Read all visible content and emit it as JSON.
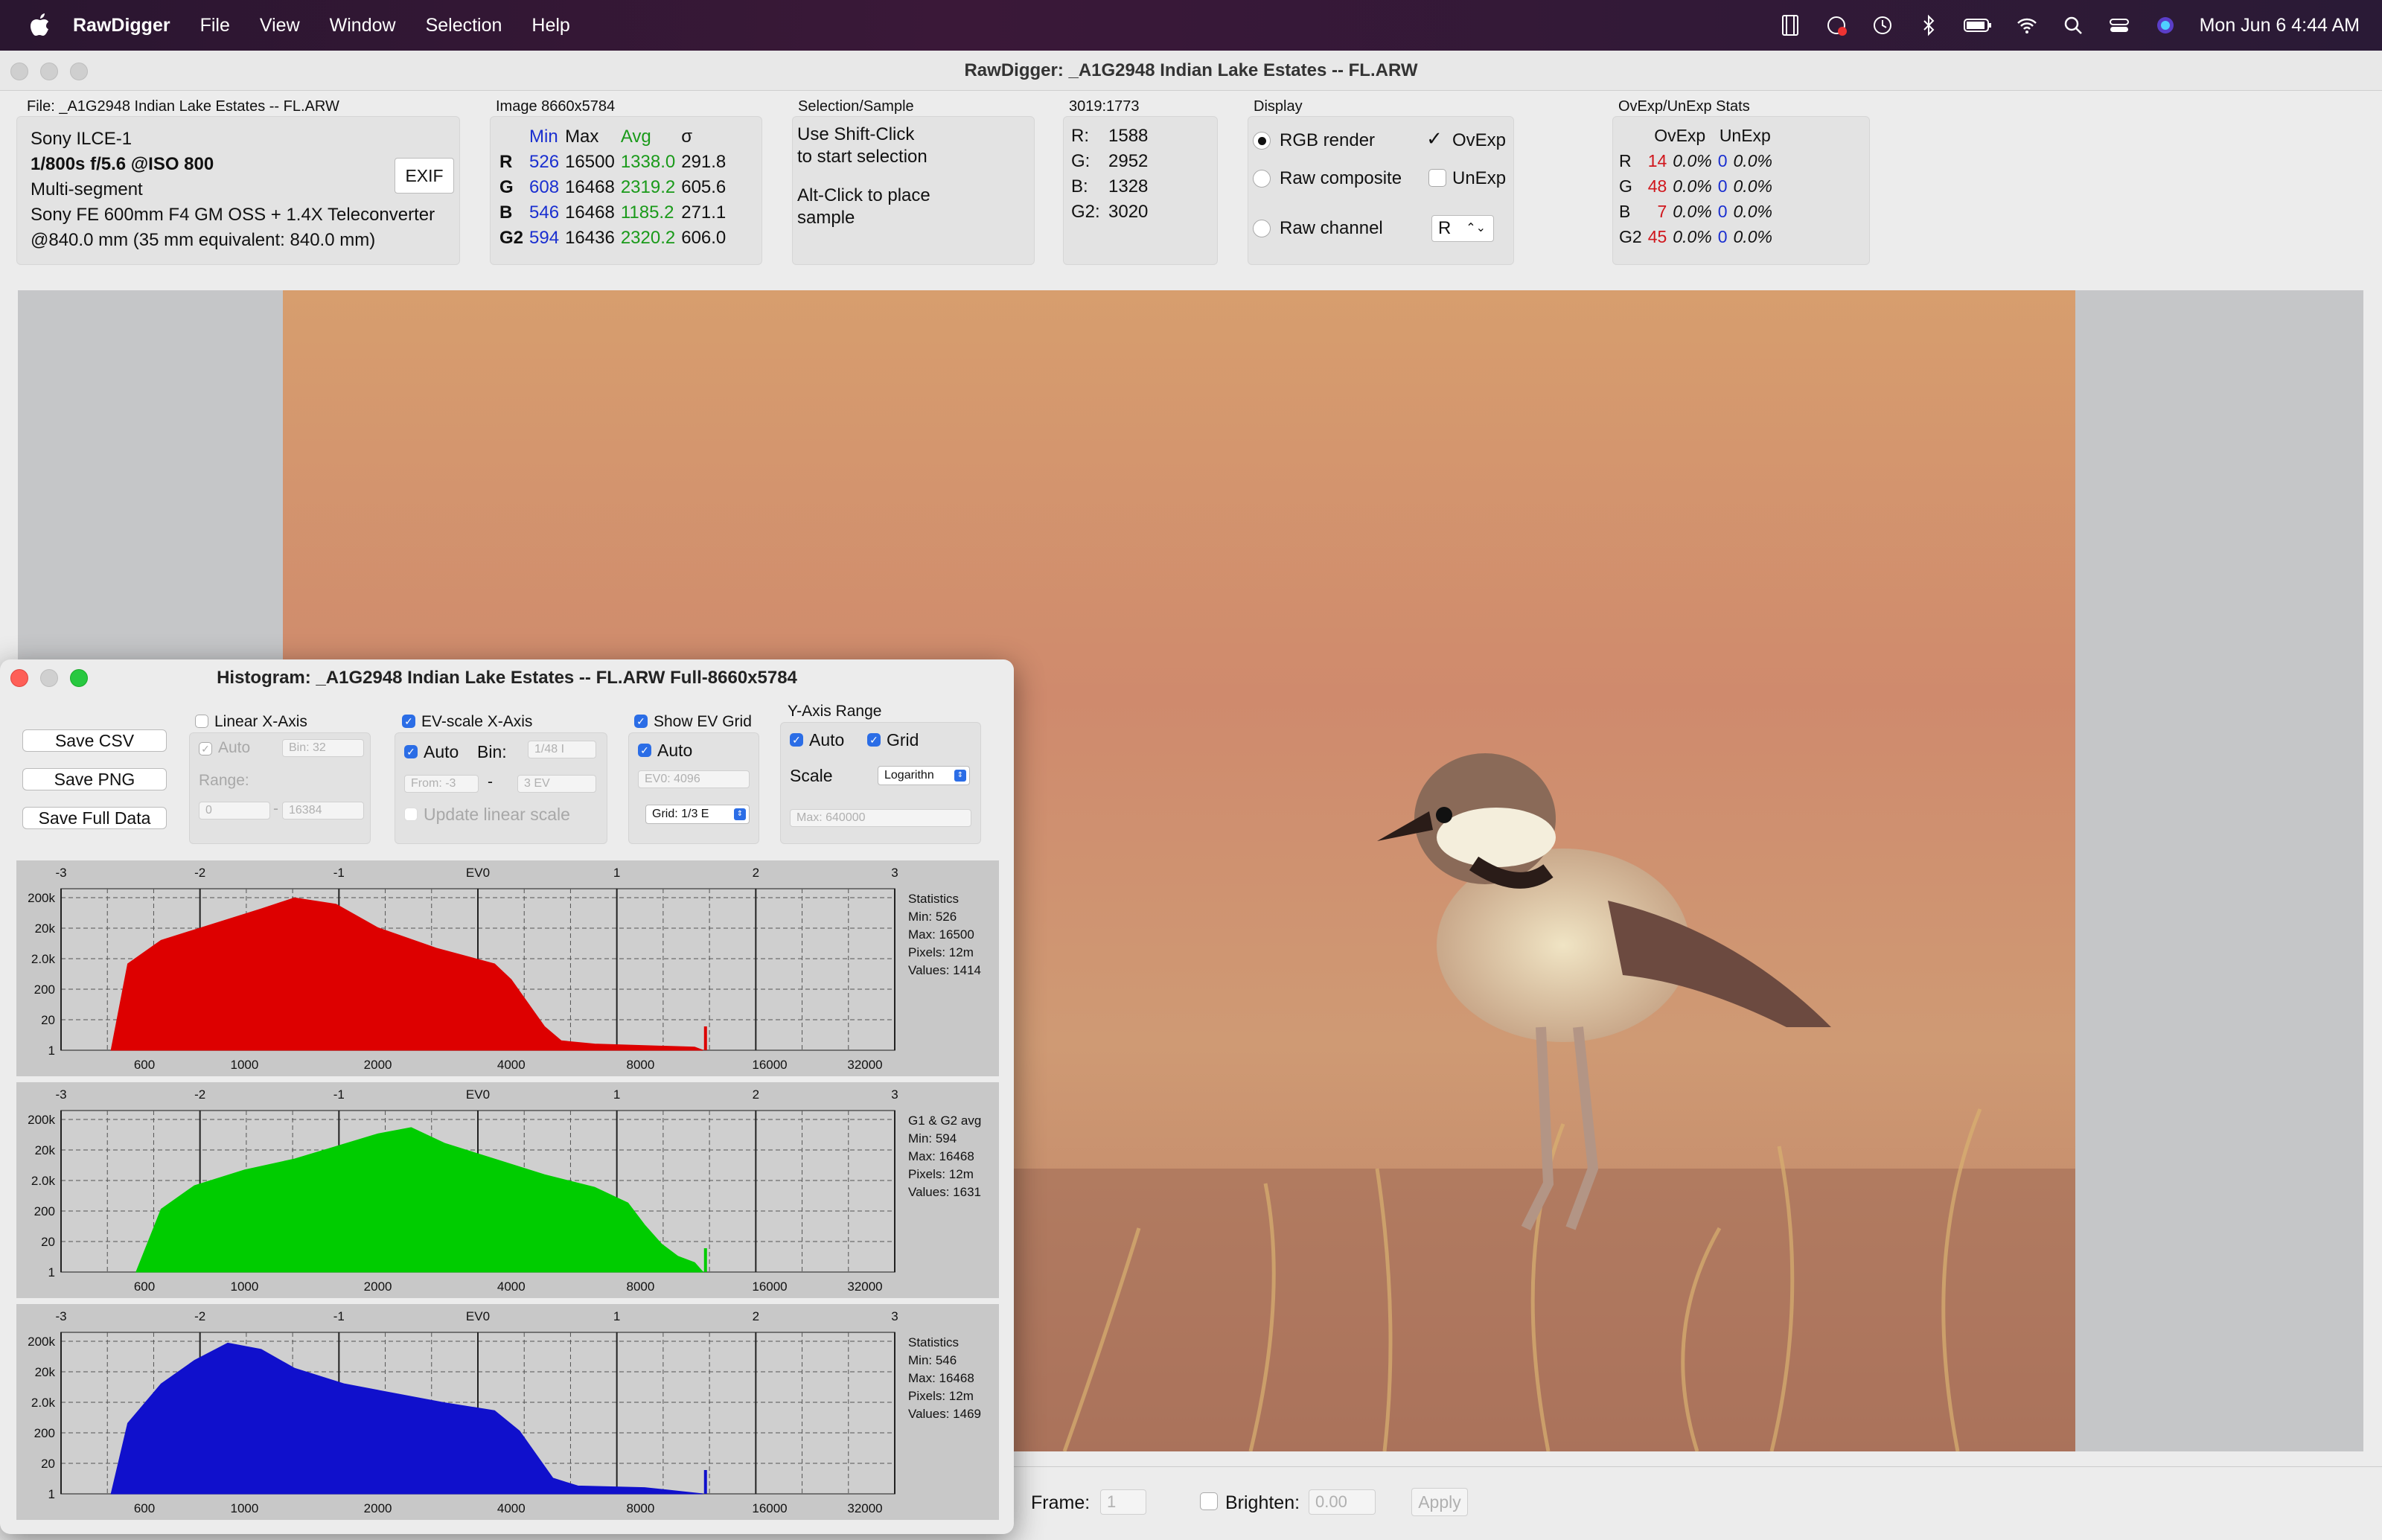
{
  "menubar": {
    "app_name": "RawDigger",
    "menus": [
      "File",
      "View",
      "Window",
      "Selection",
      "Help"
    ],
    "clock": "Mon Jun 6  4:44 AM"
  },
  "main_window": {
    "title": "RawDigger: _A1G2948 Indian Lake Estates --  FL.ARW"
  },
  "file_panel": {
    "label": "File: _A1G2948 Indian Lake Estates --  FL.ARW",
    "camera": "Sony ILCE-1",
    "exposure": "1/800s f/5.6 @ISO 800",
    "metering": "Multi-segment",
    "lens": "Sony FE 600mm F4 GM OSS + 1.4X Teleconverter",
    "focal": "@840.0 mm (35 mm equivalent: 840.0 mm)",
    "exif_button": "EXIF"
  },
  "image_panel": {
    "label": "Image 8660x5784",
    "headers": [
      "Min",
      "Max",
      "Avg",
      "σ"
    ],
    "rows": [
      {
        "ch": "R",
        "min": "526",
        "max": "16500",
        "avg": "1338.0",
        "sd": "291.8"
      },
      {
        "ch": "G",
        "min": "608",
        "max": "16468",
        "avg": "2319.2",
        "sd": "605.6"
      },
      {
        "ch": "B",
        "min": "546",
        "max": "16468",
        "avg": "1185.2",
        "sd": "271.1"
      },
      {
        "ch": "G2",
        "min": "594",
        "max": "16436",
        "avg": "2320.2",
        "sd": "606.0"
      }
    ]
  },
  "selection_panel": {
    "label": "Selection/Sample",
    "line1": "Use Shift-Click",
    "line2": "to start selection",
    "line3": "Alt-Click to place",
    "line4": "sample"
  },
  "sample_panel": {
    "label": "3019:1773",
    "rows": [
      {
        "ch": "R:",
        "val": "1588"
      },
      {
        "ch": "G:",
        "val": "2952"
      },
      {
        "ch": "B:",
        "val": "1328"
      },
      {
        "ch": "G2:",
        "val": "3020"
      }
    ]
  },
  "display_panel": {
    "label": "Display",
    "rgb_render": "RGB render",
    "raw_composite": "Raw composite",
    "raw_channel": "Raw channel",
    "ovexp": "OvExp",
    "unexp": "UnExp",
    "channel_value": "R"
  },
  "ovexp_panel": {
    "label": "OvExp/UnExp Stats",
    "headers": [
      "OvExp",
      "UnExp"
    ],
    "rows": [
      {
        "ch": "R",
        "ov_n": "14",
        "ov_p": "0.0%",
        "un_n": "0",
        "un_p": "0.0%"
      },
      {
        "ch": "G",
        "ov_n": "48",
        "ov_p": "0.0%",
        "un_n": "0",
        "un_p": "0.0%"
      },
      {
        "ch": "B",
        "ov_n": "7",
        "ov_p": "0.0%",
        "un_n": "0",
        "un_p": "0.0%"
      },
      {
        "ch": "G2",
        "ov_n": "45",
        "ov_p": "0.0%",
        "un_n": "0",
        "un_p": "0.0%"
      }
    ]
  },
  "bottom": {
    "frame_label": "Frame:",
    "frame_value": "1",
    "brighten_label": "Brighten:",
    "brighten_value": "0.00",
    "apply": "Apply"
  },
  "histogram_window": {
    "title": "Histogram: _A1G2948 Indian Lake Estates --  FL.ARW Full-8660x5784",
    "save_csv": "Save CSV",
    "save_png": "Save PNG",
    "save_full": "Save Full Data",
    "linear_x": "Linear X-Axis",
    "auto": "Auto",
    "bin_field": "Bin: 32",
    "range": "Range:",
    "range_from": "0",
    "range_to": "16384",
    "ev_scale": "EV-scale X-Axis",
    "bin_label": "Bin:",
    "bin_select": "1/48 I",
    "from_field": "From: -3",
    "to_field": "3 EV",
    "update_linear": "Update linear scale",
    "show_ev_grid": "Show EV Grid",
    "ev0_field": "EV0: 4096",
    "grid_select": "Grid: 1/3 E",
    "yaxis_range": "Y-Axis Range",
    "grid": "Grid",
    "scale": "Scale",
    "scale_select": "Logarithn",
    "max_field": "Max: 640000",
    "ev_ticks": [
      "-3",
      "-2",
      "-1",
      "EV0",
      "1",
      "2",
      "3"
    ],
    "x_ticks": [
      "600",
      "1000",
      "2000",
      "4000",
      "8000",
      "16000",
      "32000"
    ],
    "y_ticks": [
      "200k",
      "20k",
      "2.0k",
      "200",
      "20",
      "1"
    ],
    "panels": [
      {
        "name": "red",
        "color": "#dd0000",
        "stats": [
          "Statistics",
          "Min: 526",
          "Max: 16500",
          "Pixels: 12m",
          "Values: 1414"
        ]
      },
      {
        "name": "green",
        "color": "#00cc00",
        "stats": [
          "G1 & G2 avg",
          "Min: 594",
          "Max: 16468",
          "Pixels: 12m",
          "Values: 1631"
        ]
      },
      {
        "name": "blue",
        "color": "#1010cc",
        "stats": [
          "Statistics",
          "Min: 546",
          "Max: 16468",
          "Pixels: 12m",
          "Values: 1469"
        ]
      }
    ]
  }
}
